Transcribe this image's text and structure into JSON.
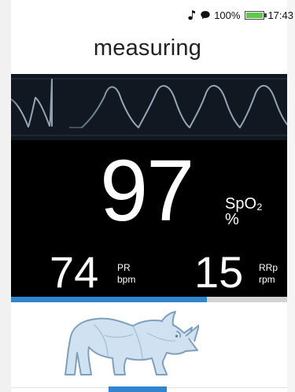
{
  "status": {
    "battery_percent": "100%",
    "battery_level": 1.0,
    "time": "17:43",
    "icons": [
      "music-note-icon",
      "message-icon",
      "battery-icon"
    ],
    "battery_color": "#62c84a"
  },
  "screen": {
    "title": "measuring"
  },
  "measurements": {
    "spo2": {
      "value": "97",
      "label": "SpO₂",
      "unit": "%"
    },
    "pr": {
      "value": "74",
      "label": "PR",
      "unit": "bpm"
    },
    "rr": {
      "value": "15",
      "label": "RRp",
      "unit": "rpm"
    }
  },
  "progress": {
    "fraction": 0.71,
    "color": "#2f86cf"
  },
  "illustration": {
    "icon": "rhino-icon"
  },
  "colors": {
    "panel": "#000000",
    "waveform_background": "#121822",
    "waveform_line": "#9eb1c1",
    "accent": "#2f86cf"
  }
}
